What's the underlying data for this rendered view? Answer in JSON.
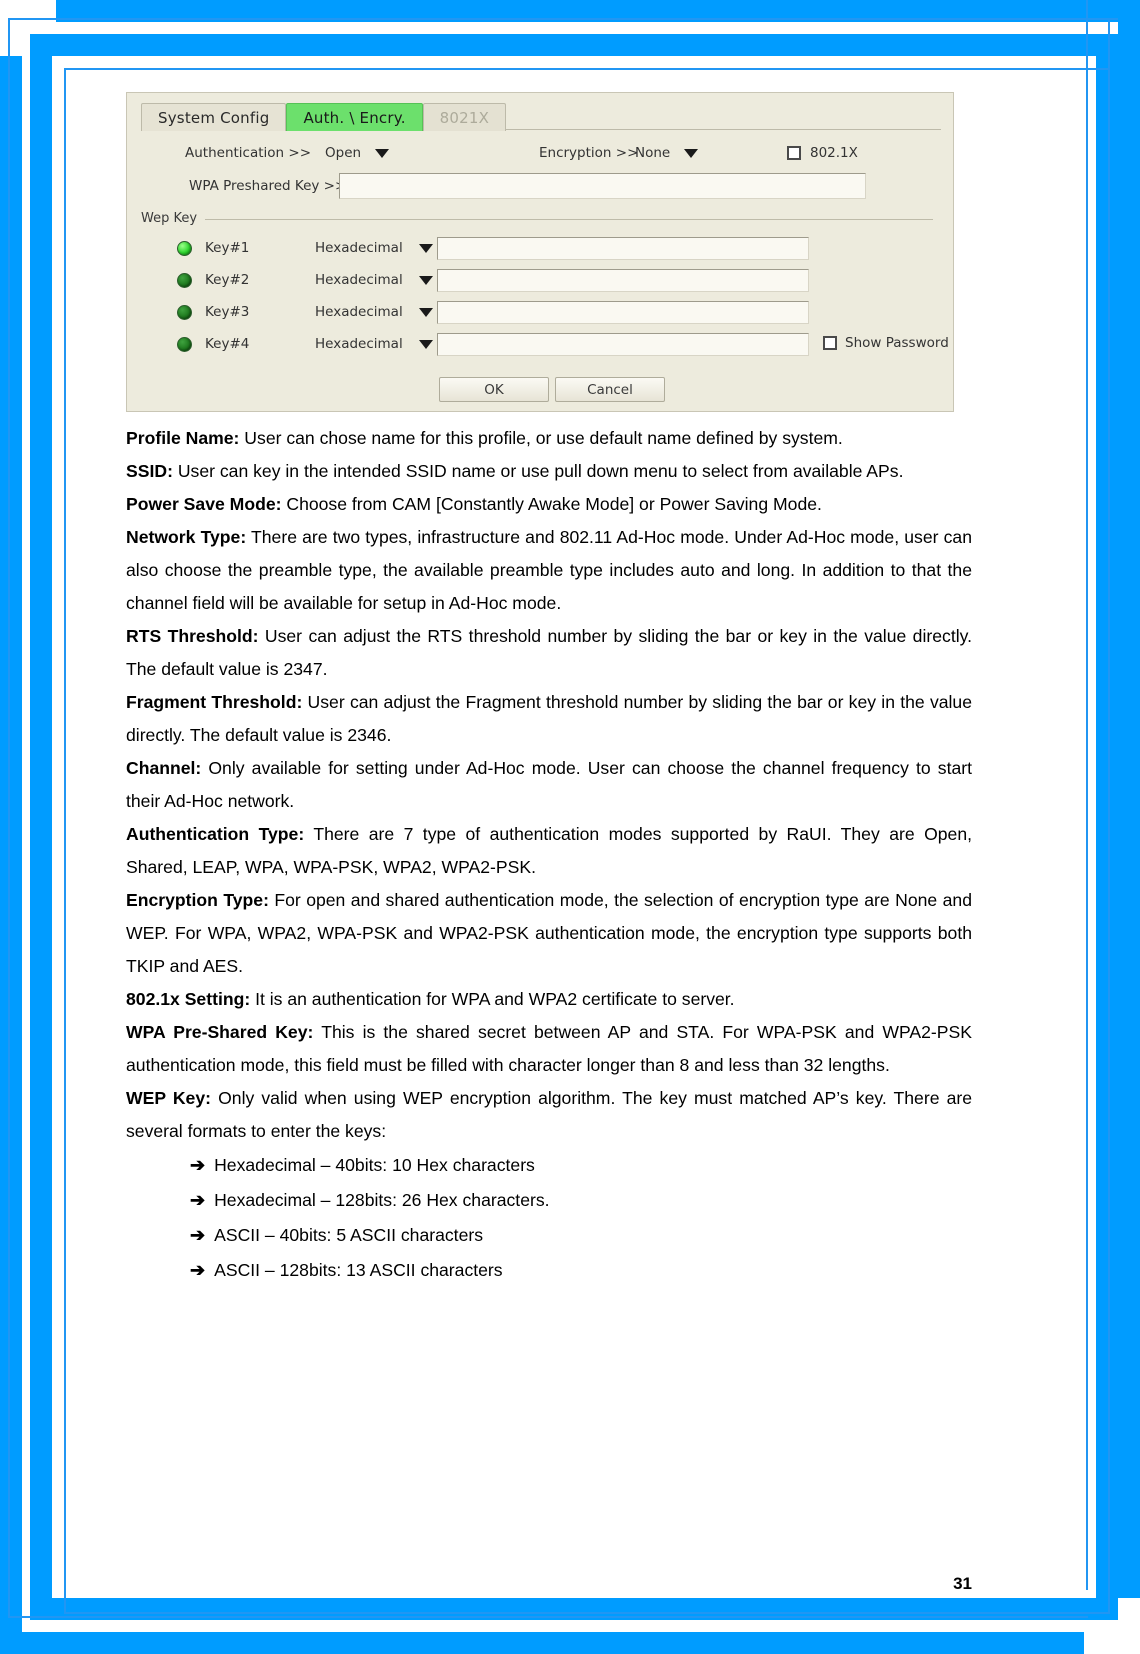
{
  "dialog": {
    "tabs": [
      {
        "label": "System Config",
        "state": "normal"
      },
      {
        "label": "Auth. \\ Encry.",
        "state": "active"
      },
      {
        "label": "8021X",
        "state": "disabled"
      }
    ],
    "authentication": {
      "label": "Authentication >>",
      "value": "Open"
    },
    "encryption": {
      "label": "Encryption >>",
      "value": "None"
    },
    "dot1x": {
      "label": "802.1X",
      "checked": false
    },
    "wpa_preshared_key": {
      "label": "WPA Preshared Key >>",
      "value": ""
    },
    "wep_group_label": "Wep Key",
    "wep_keys": [
      {
        "name": "Key#1",
        "format": "Hexadecimal",
        "value": "",
        "selected": true
      },
      {
        "name": "Key#2",
        "format": "Hexadecimal",
        "value": "",
        "selected": false
      },
      {
        "name": "Key#3",
        "format": "Hexadecimal",
        "value": "",
        "selected": false
      },
      {
        "name": "Key#4",
        "format": "Hexadecimal",
        "value": "",
        "selected": false
      }
    ],
    "show_password": {
      "label": "Show Password",
      "checked": false
    },
    "buttons": {
      "ok": "OK",
      "cancel": "Cancel"
    }
  },
  "body": {
    "p_profile_name_term": "Profile Name:",
    "p_profile_name_text": " User can chose name for this profile, or use default name defined by system.",
    "p_ssid_term": "SSID:",
    "p_ssid_text": " User can key in the intended SSID name or use pull down menu to select from available APs.",
    "p_power_save_term": "Power Save Mode:",
    "p_power_save_text": " Choose from CAM [Constantly Awake Mode] or Power Saving Mode.",
    "p_network_type_term": "Network Type:",
    "p_network_type_text": " There are two types, infrastructure and 802.11 Ad-Hoc mode. Under Ad-Hoc mode, user can also choose the preamble type, the available preamble type includes auto and long. In addition to that the channel field will be available for setup in Ad-Hoc mode.",
    "p_rts_term": "RTS Threshold:",
    "p_rts_text": " User can adjust the RTS threshold number by sliding the bar or key in the value directly. The default value is 2347.",
    "p_fragment_term": "Fragment Threshold:",
    "p_fragment_text": " User can adjust the Fragment threshold number by sliding the bar or key in the value directly. The default value is 2346.",
    "p_channel_term": "Channel:",
    "p_channel_text": " Only available for setting under Ad-Hoc mode. User can choose the channel frequency to start their Ad-Hoc network.",
    "p_auth_type_term": "Authentication Type:",
    "p_auth_type_text": " There are 7 type of authentication modes supported by RaUI. They are Open, Shared, LEAP, WPA, WPA-PSK, WPA2, WPA2-PSK.",
    "p_encryption_type_term": "Encryption Type:",
    "p_encryption_type_text": " For open and shared authentication mode, the selection of encryption type are None and WEP. For WPA, WPA2, WPA-PSK and WPA2-PSK authentication mode, the encryption type supports both TKIP and AES.",
    "p_8021x_term": "802.1x Setting:",
    "p_8021x_text": " It is an authentication for WPA and WPA2 certificate to server.",
    "p_wpa_psk_term": "WPA Pre-Shared Key:",
    "p_wpa_psk_text": " This is the shared secret between AP and STA. For WPA-PSK and WPA2-PSK authentication mode, this field must be filled with character longer than 8 and less than 32 lengths.",
    "p_wep_key_term": "WEP Key:",
    "p_wep_key_text": " Only valid when using WEP encryption algorithm. The key must matched AP’s key. There are several formats to enter the keys:",
    "bullets": [
      "Hexadecimal – 40bits: 10 Hex characters",
      "Hexadecimal – 128bits: 26 Hex characters.",
      "ASCII – 40bits: 5 ASCII characters",
      "ASCII – 128bits: 13 ASCII characters"
    ],
    "bullet_arrow": "➔"
  },
  "footer": {
    "page_number": "31"
  },
  "colors": {
    "frame_blue": "#009CFF",
    "active_tab_green": "#6CE06C",
    "dialog_bg": "#EDEBDD",
    "led_on": "#2fd62f",
    "led_off": "#1f7a1f"
  }
}
